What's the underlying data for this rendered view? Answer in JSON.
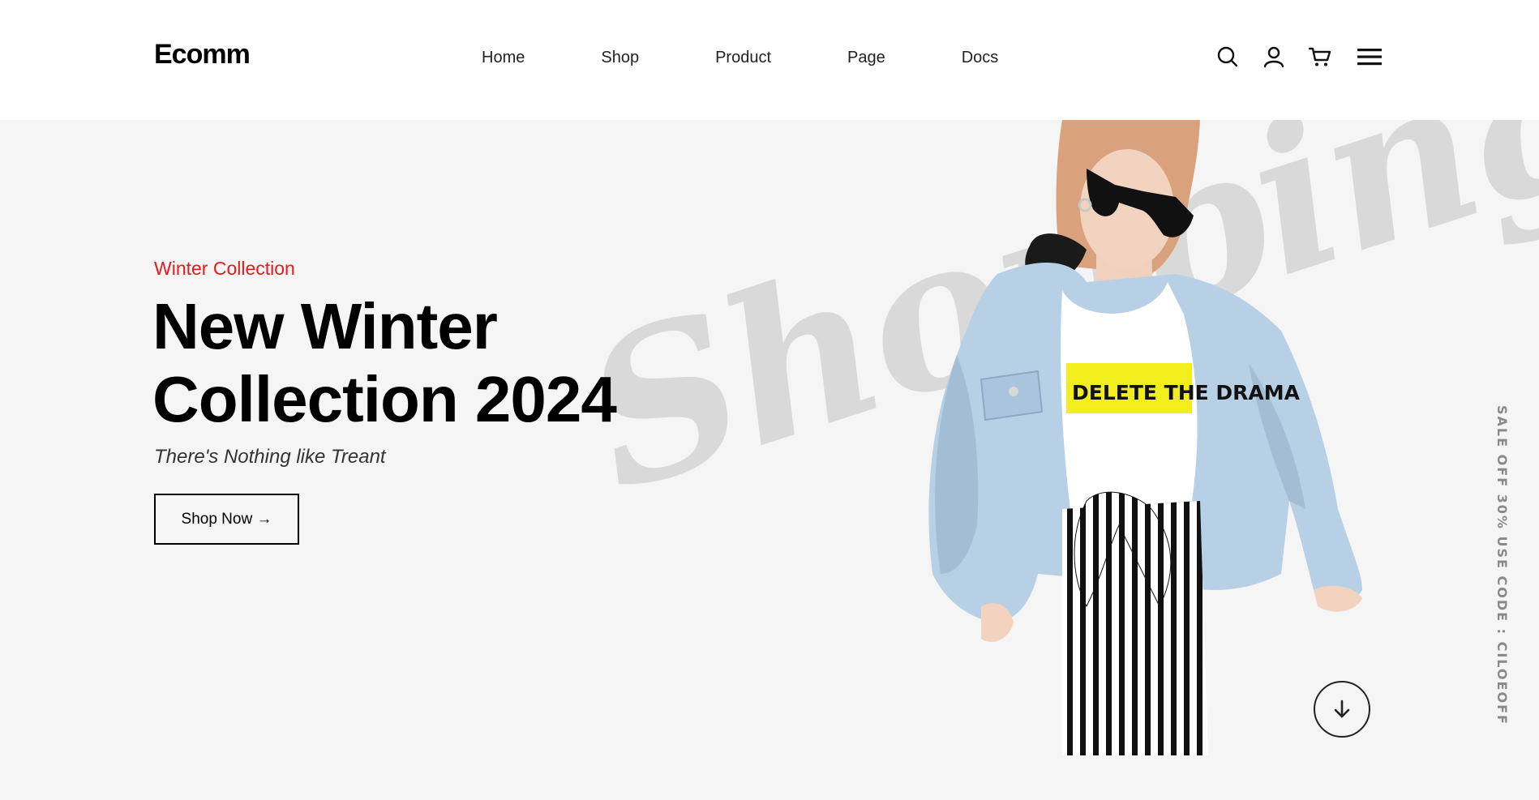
{
  "header": {
    "logo": "Ecomm",
    "nav": [
      {
        "label": "Home"
      },
      {
        "label": "Shop"
      },
      {
        "label": "Product"
      },
      {
        "label": "Page"
      },
      {
        "label": "Docs"
      }
    ],
    "icons": [
      "search-icon",
      "user-icon",
      "cart-icon",
      "menu-icon"
    ]
  },
  "hero": {
    "subtitle": "Winter Collection",
    "title_line1": "New Winter",
    "title_line2": "Collection 2024",
    "tagline": "There's Nothing like Treant",
    "button_label": "Shop Now →",
    "watermark": "Shopping",
    "shirt_text": "DELETE THE DRAMA",
    "side_promo": "SALE OFF 30% USE CODE : CILOEOFF"
  },
  "colors": {
    "accent": "#e31b1b",
    "hero_bg": "#f5f5f5",
    "text": "#000000",
    "jacket": "#b8d0e6",
    "shirt_band": "#f2ee1e"
  }
}
